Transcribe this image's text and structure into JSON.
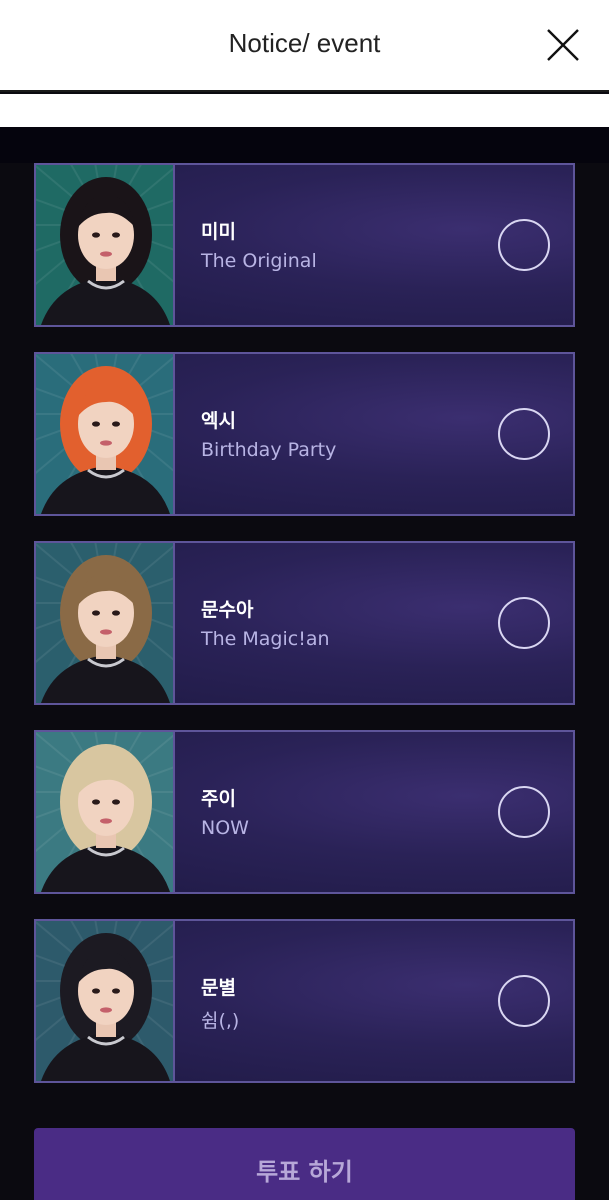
{
  "header": {
    "title": "Notice/ event",
    "close_icon": "close-icon"
  },
  "colors": {
    "card_border": "#5e559a",
    "card_bg": "#2a2257",
    "song_text": "#b8b4e4",
    "vote_button": "#4a2c85"
  },
  "candidates": [
    {
      "name": "미미",
      "song": "The Original",
      "selected": false,
      "hair": "#1a1418",
      "bg": "#1f6a64"
    },
    {
      "name": "엑시",
      "song": "Birthday Party",
      "selected": false,
      "hair": "#e2602e",
      "bg": "#2a6d7b"
    },
    {
      "name": "문수아",
      "song": "The Magic!an",
      "selected": false,
      "hair": "#8a6a46",
      "bg": "#2b5f6d"
    },
    {
      "name": "주이",
      "song": "NOW",
      "selected": false,
      "hair": "#d8c6a0",
      "bg": "#3b7a82"
    },
    {
      "name": "문별",
      "song": "쉼(,)",
      "selected": false,
      "hair": "#1c1a22",
      "bg": "#2d5a6b"
    }
  ],
  "vote_button": {
    "label": "투표 하기"
  }
}
